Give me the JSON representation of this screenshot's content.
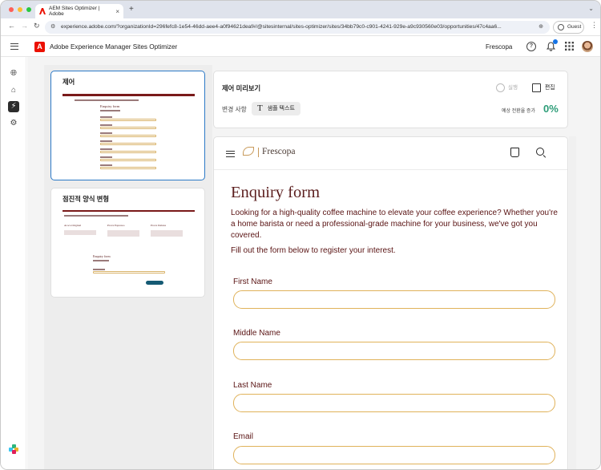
{
  "browser": {
    "tab_title": "AEM Sites Optimizer | Adobe",
    "url": "experience.adobe.com/?organizationId=296fefc8-1e54-46dd-aee4-a0f94621deaf#/@sitesinternal/sites-optimizer/sites/34bb79c0-c901-4241-929e-a9c930560e03/opportunities/47c4aa6...",
    "guest_label": "Guest"
  },
  "app": {
    "title": "Adobe Experience Manager Sites Optimizer",
    "org": "Frescopa"
  },
  "variants": [
    {
      "title": "제어",
      "selected": true,
      "thumb_title": "Enquiry form"
    },
    {
      "title": "점진적 양식 변형",
      "selected": false,
      "thumb_title": "Enquiry form",
      "cards": [
        "Aroca Original",
        "Prova Espresso",
        "Prova Deluxe"
      ]
    }
  ],
  "preview": {
    "title": "제어 미리보기",
    "apply_label": "실행",
    "edit_label": "편집",
    "changes_label": "변경 사항",
    "sample_text_label": "샘플 텍스트",
    "conversion_label": "예상 전환율 증가",
    "conversion_value": "0%"
  },
  "site": {
    "brand": "Frescopa",
    "form_title": "Enquiry form",
    "intro": "Looking for a high-quality coffee machine to elevate your coffee experience? Whether you're a home barista or need a professional-grade machine for your business, we've got you covered.",
    "fill_text": "Fill out the form below to register your interest.",
    "fields": [
      {
        "label": "First Name"
      },
      {
        "label": "Middle Name"
      },
      {
        "label": "Last Name"
      },
      {
        "label": "Email"
      }
    ]
  },
  "colors": {
    "accent": "#2c79c6",
    "conversion": "#2d9d78",
    "brand_text": "#5b1e1e",
    "field_border": "#e0b25a",
    "adobe_red": "#eb1000"
  }
}
